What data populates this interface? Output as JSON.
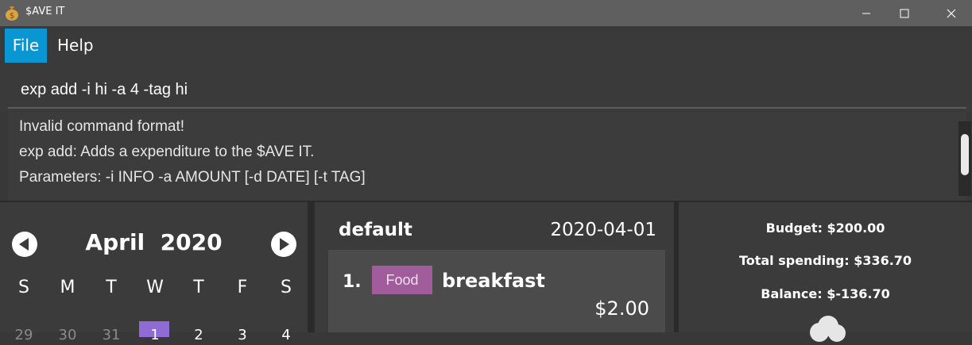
{
  "window": {
    "title": "$AVE IT"
  },
  "menu": {
    "file": "File",
    "help": "Help"
  },
  "command": {
    "value": "exp add -i hi -a 4 -tag hi"
  },
  "result": {
    "lines": [
      "Invalid command format!",
      "exp add: Adds a expenditure to the $AVE IT.",
      "Parameters: -i INFO -a AMOUNT [-d DATE] [-t TAG]"
    ]
  },
  "calendar": {
    "month": "April",
    "year": "2020",
    "weekdays": [
      "S",
      "M",
      "T",
      "W",
      "T",
      "F",
      "S"
    ],
    "first_row": [
      "29",
      "30",
      "31",
      "1",
      "2",
      "3",
      "4"
    ]
  },
  "account": {
    "name": "default",
    "date": "2020-04-01",
    "items": [
      {
        "index": "1.",
        "tag": "Food",
        "info": "breakfast",
        "amount": "$2.00"
      }
    ]
  },
  "stats": {
    "budget": "Budget: $200.00",
    "total": "Total spending: $336.70",
    "balance": "Balance: $-136.70"
  },
  "colors": {
    "accent": "#0a96d2",
    "tag_food": "#a05c9b",
    "today": "#8f6bd6"
  }
}
